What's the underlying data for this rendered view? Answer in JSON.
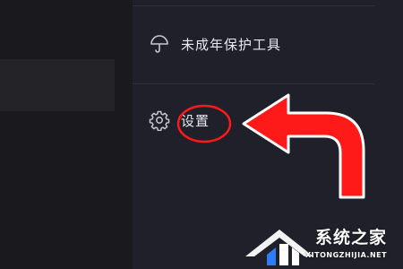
{
  "menu": {
    "items": [
      {
        "label": "未成年保护工具",
        "icon": "umbrella-icon"
      },
      {
        "label": "设置",
        "icon": "gear-icon"
      }
    ]
  },
  "annotation": {
    "color": "#ff1a1a"
  },
  "watermark": {
    "title": "系统之家",
    "url": "XITONGZHIJIA.NET"
  },
  "colors": {
    "background": "#1a1a1f",
    "panel": "#1f2029",
    "text": "#e8e8ee",
    "accent_red": "#ff1a1a"
  }
}
